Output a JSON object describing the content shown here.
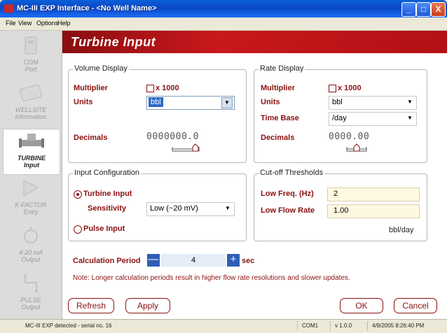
{
  "window": {
    "title": "MC-III EXP Interface - <No Well Name>",
    "minimize_label": "_",
    "maximize_label": "□",
    "close_label": "X"
  },
  "menu": [
    "File",
    "View",
    "Options",
    "Help"
  ],
  "sidebar": {
    "items": [
      {
        "line1": "COM",
        "line2": "Port"
      },
      {
        "line1": "WELLSITE",
        "line2": "Information"
      },
      {
        "line1": "TURBINE",
        "line2": "Input"
      },
      {
        "line1": "K-FACTOR",
        "line2": "Entry"
      },
      {
        "line1": "4-20 mA",
        "line2": "Output"
      },
      {
        "line1": "PULSE",
        "line2": "Output"
      }
    ]
  },
  "page_title": "Turbine Input",
  "volume_display": {
    "title": "Volume Display",
    "multiplier_label": "Multiplier",
    "multiplier_value": "x 1000",
    "units_label": "Units",
    "units_value": "bbl",
    "decimals_label": "Decimals",
    "decimals_value": "0000000.0"
  },
  "rate_display": {
    "title": "Rate Display",
    "multiplier_label": "Multiplier",
    "multiplier_value": "x 1000",
    "units_label": "Units",
    "units_value": "bbl",
    "timebase_label": "Time Base",
    "timebase_value": "/day",
    "decimals_label": "Decimals",
    "decimals_value": "0000.00"
  },
  "input_config": {
    "title": "Input Configuration",
    "turbine_label": "Turbine Input",
    "sensitivity_label": "Sensitivity",
    "sensitivity_value": "Low (~20 mV)",
    "pulse_label": "Pulse Input"
  },
  "cutoff": {
    "title": "Cut-off Thresholds",
    "low_freq_label": "Low Freq. (Hz)",
    "low_freq_value": "2",
    "low_flow_label": "Low Flow Rate",
    "low_flow_value": "1.00",
    "unit": "bbl/day"
  },
  "calc_period": {
    "label": "Calculation Period",
    "value": "4",
    "unit": "sec",
    "minus": "—",
    "plus": "+"
  },
  "note": "Note: Longer calculation periods result in higher flow rate resolutions and slower updates.",
  "buttons": {
    "refresh": "Refresh",
    "apply": "Apply",
    "ok": "OK",
    "cancel": "Cancel"
  },
  "status": {
    "message": "MC-III EXP detected - serial no. 16",
    "port": "COM1",
    "version": "v 1.0.0",
    "datetime": "4/9/2005 8:26:40 PM"
  },
  "colors": {
    "accent": "#8a1010",
    "header": "#c8181c",
    "titlebar": "#0a47c6"
  }
}
